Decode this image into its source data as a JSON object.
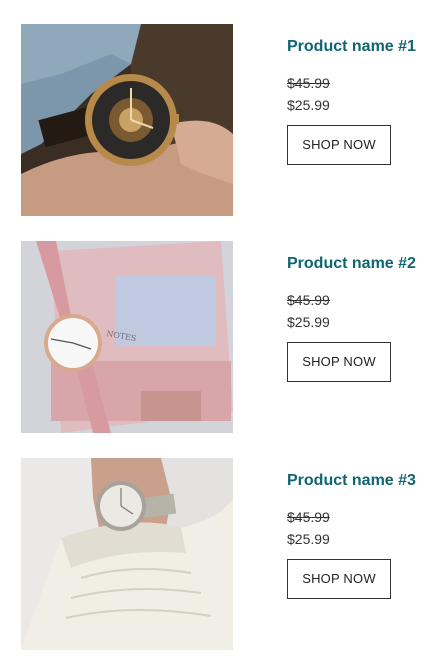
{
  "products": [
    {
      "name": "Product name #1",
      "old_price": "$45.99",
      "new_price": "$25.99",
      "cta": "SHOP NOW",
      "image": "watch-skeleton-dial-on-wrist"
    },
    {
      "name": "Product name #2",
      "old_price": "$45.99",
      "new_price": "$25.99",
      "cta": "SHOP NOW",
      "image": "pink-watch-on-notebook"
    },
    {
      "name": "Product name #3",
      "old_price": "$45.99",
      "new_price": "$25.99",
      "cta": "SHOP NOW",
      "image": "watch-on-wrist-white-sweater"
    }
  ],
  "colors": {
    "title": "#106571",
    "text": "#333333",
    "button_border": "#333333"
  }
}
